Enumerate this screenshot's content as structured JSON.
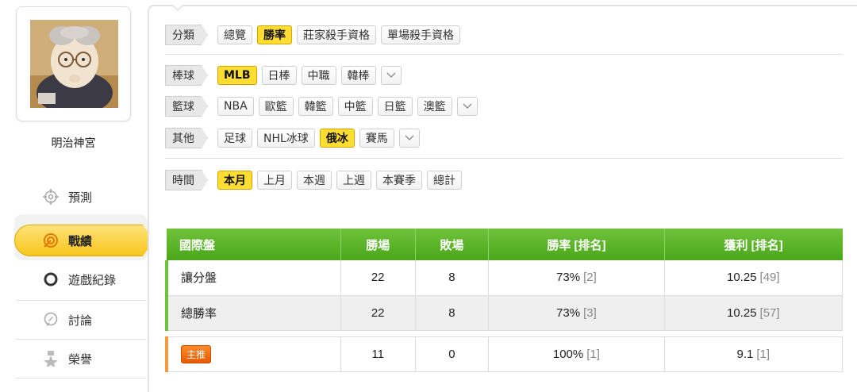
{
  "user": {
    "name": "明治神宮"
  },
  "menu": [
    {
      "label": "預測",
      "icon": "crosshair-icon",
      "active": false
    },
    {
      "label": "戰績",
      "icon": "target-icon",
      "active": true
    },
    {
      "label": "遊戲紀錄",
      "icon": "circle-icon",
      "active": false
    },
    {
      "label": "討論",
      "icon": "chat-bubble-icon",
      "active": false
    },
    {
      "label": "榮譽",
      "icon": "medal-icon",
      "active": false
    }
  ],
  "filters": {
    "category": {
      "label": "分類",
      "options": [
        "總覽",
        "勝率",
        "莊家殺手資格",
        "單場殺手資格"
      ],
      "selected": "勝率"
    },
    "baseball": {
      "label": "棒球",
      "options": [
        "MLB",
        "日棒",
        "中職",
        "韓棒"
      ],
      "selected": "MLB"
    },
    "basketball": {
      "label": "籃球",
      "options": [
        "NBA",
        "歐籃",
        "韓籃",
        "中籃",
        "日籃",
        "澳籃"
      ],
      "selected": ""
    },
    "other": {
      "label": "其他",
      "options": [
        "足球",
        "NHL冰球",
        "俄冰",
        "賽馬"
      ],
      "selected": "俄冰"
    },
    "time": {
      "label": "時間",
      "options": [
        "本月",
        "上月",
        "本週",
        "上週",
        "本賽季",
        "總計"
      ],
      "selected": "本月"
    }
  },
  "table": {
    "headers": [
      "國際盤",
      "勝場",
      "敗場",
      "勝率 [排名]",
      "獲利 [排名]"
    ],
    "rows": [
      {
        "name": "讓分盤",
        "wins": "22",
        "losses": "8",
        "rate": "73%",
        "rate_rank": "[2]",
        "profit": "10.25",
        "profit_rank": "[49]"
      },
      {
        "name": "總勝率",
        "wins": "22",
        "losses": "8",
        "rate": "73%",
        "rate_rank": "[3]",
        "profit": "10.25",
        "profit_rank": "[57]"
      }
    ],
    "hot_row": {
      "badge": "主推",
      "wins": "11",
      "losses": "0",
      "rate": "100%",
      "rate_rank": "[1]",
      "profit": "9.1",
      "profit_rank": "[1]"
    }
  },
  "colors": {
    "accent_yellow": "#ffdd33",
    "table_green": "#5cb82a",
    "hot_orange": "#f07a1a"
  }
}
